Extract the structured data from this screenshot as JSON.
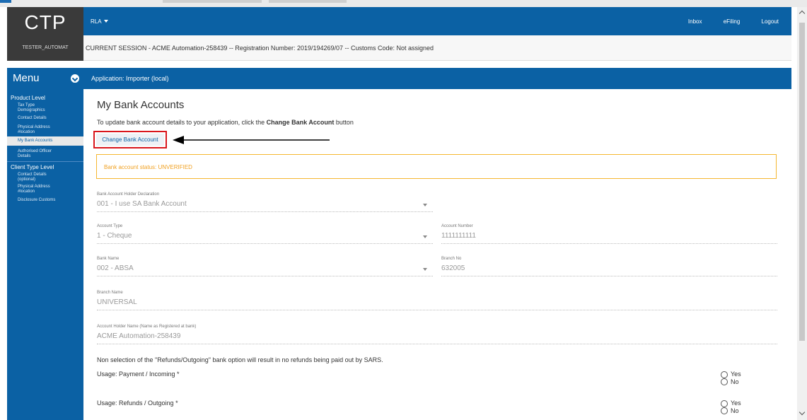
{
  "header": {
    "logo": "CTP",
    "username": "TESTER_AUTOMAT",
    "rla_label": "RLA",
    "nav_links": [
      "Inbox",
      "eFiling",
      "Logout"
    ],
    "session_text": "CURRENT SESSION - ACME Automation-258439 -- Registration Number: 2019/194269/07 -- Customs Code: Not assigned"
  },
  "menu": {
    "title": "Menu",
    "sections": [
      {
        "label": "Product Level",
        "items": [
          {
            "label": "Tax Type Demographics"
          },
          {
            "label": "Contact Details"
          },
          {
            "label": "Physical Address #location"
          },
          {
            "label": "My Bank Accounts",
            "active": true
          },
          {
            "label": "Authorised Officer Details"
          }
        ]
      },
      {
        "label": "Client Type Level",
        "items": [
          {
            "label": "Contact Details (optional)"
          },
          {
            "label": "Physical Address #location"
          },
          {
            "label": "Disclosure Customs"
          }
        ]
      }
    ]
  },
  "app": {
    "title": "Application: Importer (local)"
  },
  "page": {
    "title": "My Bank Accounts",
    "intro_pre": "To update bank account details to your application, click the ",
    "intro_bold": "Change Bank Account",
    "intro_post": " button",
    "change_button": "Change Bank Account",
    "status": "Bank account status: UNVERIFIED"
  },
  "form": {
    "holder_declaration": {
      "label": "Bank Account Holder Declaration",
      "value": "001 - I use SA Bank Account"
    },
    "account_type": {
      "label": "Account Type",
      "value": "1 - Cheque"
    },
    "account_number": {
      "label": "Account Number",
      "value": "1111111111"
    },
    "bank_name": {
      "label": "Bank Name",
      "value": "002 - ABSA"
    },
    "branch_no": {
      "label": "Branch No",
      "value": "632005"
    },
    "branch_name": {
      "label": "Branch Name",
      "value": "UNIVERSAL"
    },
    "holder_name": {
      "label": "Account Holder Name (Name as Registered at bank)",
      "value": "ACME Automation-258439"
    }
  },
  "usage": {
    "note": "Non selection of the \"Refunds/Outgoing\" bank option will result in no refunds being paid out by SARS.",
    "payment_label": "Usage: Payment / Incoming *",
    "refunds_label": "Usage: Refunds / Outgoing *",
    "yes": "Yes",
    "no": "No"
  },
  "colors": {
    "primary": "#0b61a4",
    "logo_bg": "#3a3a3a",
    "highlight": "#d9161c",
    "warning": "#f5b731"
  }
}
